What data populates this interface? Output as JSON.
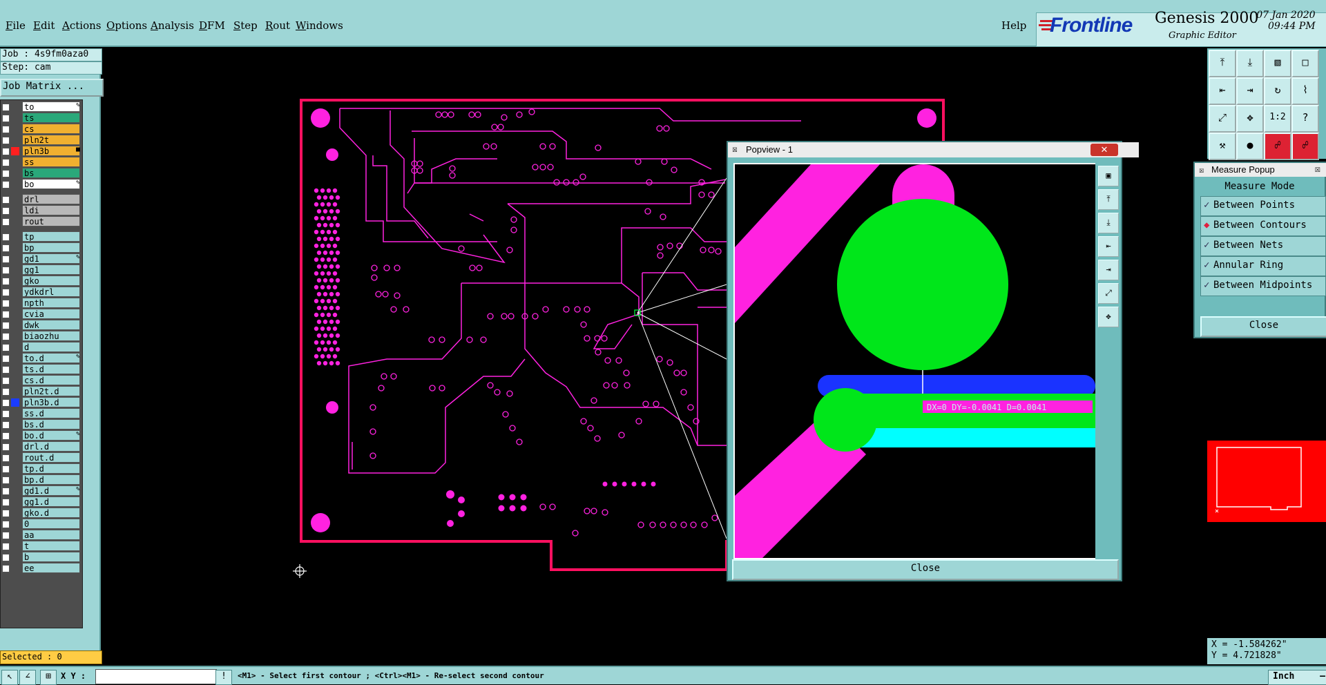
{
  "menu": {
    "items": [
      "File",
      "Edit",
      "Actions",
      "Options",
      "Analysis",
      "DFM",
      "Step",
      "Rout",
      "Windows"
    ],
    "help": "Help"
  },
  "brand": {
    "logo": "Frontline",
    "product": "Genesis 2000",
    "subtitle": "Graphic Editor",
    "date": "07 Jan 2020",
    "time": "09:44 PM"
  },
  "job": {
    "job_label": "Job : 4s9fm0aza0",
    "step_label": "Step: cam",
    "matrix_button": "Job Matrix ..."
  },
  "layers": [
    {
      "name": "to",
      "bg": "#ffffff",
      "flag": "✎"
    },
    {
      "name": "ts",
      "bg": "#2aa87a"
    },
    {
      "name": "cs",
      "bg": "#f0b030"
    },
    {
      "name": "pln2t",
      "bg": "#f0b030"
    },
    {
      "name": "pln3b",
      "bg": "#f0b030",
      "mark": "#ff2020",
      "flag": "■"
    },
    {
      "name": "ss",
      "bg": "#f0b030"
    },
    {
      "name": "bs",
      "bg": "#2aa87a"
    },
    {
      "name": "bo",
      "bg": "#ffffff",
      "flag": "✎"
    },
    {
      "name": "drl",
      "bg": "#b8b8b8"
    },
    {
      "name": "ldi",
      "bg": "#b8b8b8"
    },
    {
      "name": "rout",
      "bg": "#b8b8b8"
    },
    {
      "name": "tp",
      "bg": "#9ed6d6"
    },
    {
      "name": "bp",
      "bg": "#9ed6d6"
    },
    {
      "name": "gd1",
      "bg": "#9ed6d6",
      "flag": "✎"
    },
    {
      "name": "gg1",
      "bg": "#9ed6d6"
    },
    {
      "name": "gko",
      "bg": "#9ed6d6"
    },
    {
      "name": "ydkdrl",
      "bg": "#9ed6d6"
    },
    {
      "name": "npth",
      "bg": "#9ed6d6"
    },
    {
      "name": "cvia",
      "bg": "#9ed6d6"
    },
    {
      "name": "dwk",
      "bg": "#9ed6d6"
    },
    {
      "name": "biaozhu",
      "bg": "#9ed6d6"
    },
    {
      "name": "d",
      "bg": "#9ed6d6"
    },
    {
      "name": "to.d",
      "bg": "#9ed6d6",
      "flag": "✎"
    },
    {
      "name": "ts.d",
      "bg": "#9ed6d6"
    },
    {
      "name": "cs.d",
      "bg": "#9ed6d6"
    },
    {
      "name": "pln2t.d",
      "bg": "#9ed6d6"
    },
    {
      "name": "pln3b.d",
      "bg": "#9ed6d6",
      "mark": "#1a3cff"
    },
    {
      "name": "ss.d",
      "bg": "#9ed6d6"
    },
    {
      "name": "bs.d",
      "bg": "#9ed6d6"
    },
    {
      "name": "bo.d",
      "bg": "#9ed6d6",
      "flag": "✎"
    },
    {
      "name": "drl.d",
      "bg": "#9ed6d6"
    },
    {
      "name": "rout.d",
      "bg": "#9ed6d6"
    },
    {
      "name": "tp.d",
      "bg": "#9ed6d6"
    },
    {
      "name": "bp.d",
      "bg": "#9ed6d6"
    },
    {
      "name": "gd1.d",
      "bg": "#9ed6d6",
      "flag": "✎"
    },
    {
      "name": "gg1.d",
      "bg": "#9ed6d6"
    },
    {
      "name": "gko.d",
      "bg": "#9ed6d6"
    },
    {
      "name": "0",
      "bg": "#9ed6d6"
    },
    {
      "name": "aa",
      "bg": "#9ed6d6"
    },
    {
      "name": "t",
      "bg": "#9ed6d6"
    },
    {
      "name": "b",
      "bg": "#9ed6d6"
    },
    {
      "name": "ee",
      "bg": "#9ed6d6"
    }
  ],
  "selected": "Selected : 0",
  "status": {
    "xy_label": "X Y :",
    "xy_value": "",
    "prompt": "<M1> - Select first contour ; <Ctrl><M1> - Re-select second contour",
    "unit": "Inch"
  },
  "popview": {
    "title": "Popview - 1",
    "measure_readout": "DX=0 DY=-0.0041 D=0.0041",
    "close": "Close"
  },
  "measure_popup": {
    "title": "Measure Popup",
    "heading": "Measure Mode",
    "options": [
      {
        "label": "Between Points",
        "selected": false
      },
      {
        "label": "Between Contours",
        "selected": true
      },
      {
        "label": "Between Nets",
        "selected": false
      },
      {
        "label": "Annular Ring",
        "selected": false
      },
      {
        "label": "Between Midpoints",
        "selected": false
      }
    ],
    "close": "Close"
  },
  "cursor": {
    "x": "X = -1.584262\"",
    "y": "Y = 4.721828\""
  },
  "colors": {
    "panel": "#9ed6d6",
    "trace": "#ff22e0",
    "board_outline": "#ff1060",
    "pad_green": "#00e61a",
    "pad_blue": "#1a33ff",
    "pad_cyan": "#00ffff",
    "overview": "#ff0000"
  }
}
